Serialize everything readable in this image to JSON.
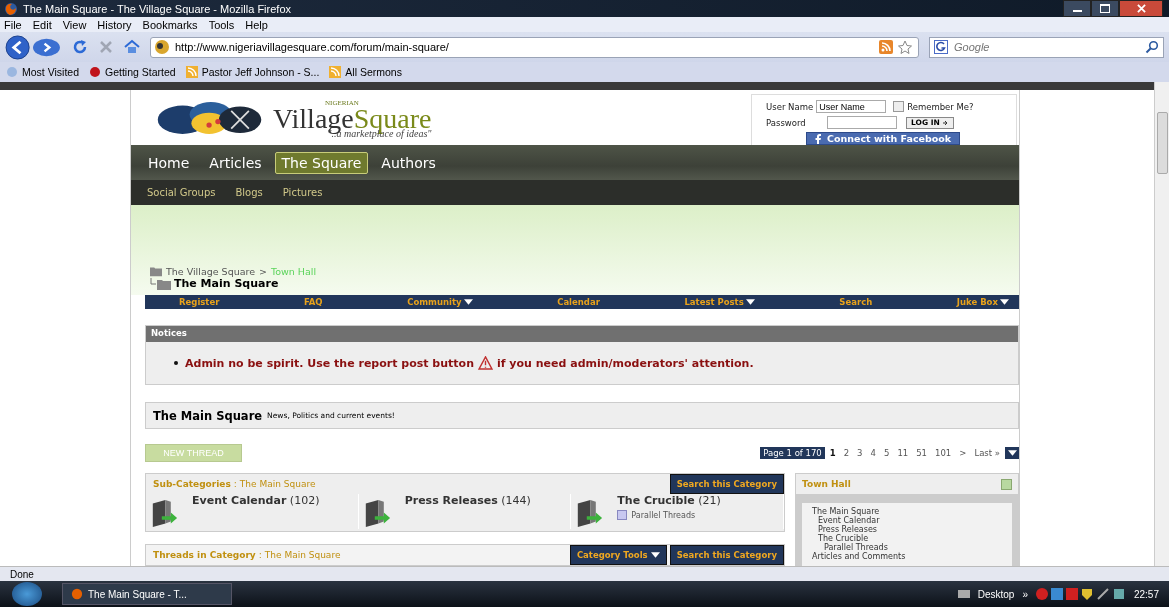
{
  "window": {
    "title": "The Main Square - The Village Square - Mozilla Firefox"
  },
  "menu": [
    "File",
    "Edit",
    "View",
    "History",
    "Bookmarks",
    "Tools",
    "Help"
  ],
  "toolbar": {
    "url": "http://www.nigeriavillagesquare.com/forum/main-square/",
    "search_placeholder": "Google"
  },
  "bookmarks": [
    "Most Visited",
    "Getting Started",
    "Pastor Jeff Johnson - S...",
    "All Sermons"
  ],
  "logo": {
    "small": "NIGERIAN",
    "word1": "Village",
    "word2": "Square",
    "tagline": "\"..a marketplace of ideas\""
  },
  "login": {
    "username_label": "User Name",
    "username_value": "User Name",
    "remember_label": "Remember Me?",
    "remember": false,
    "password_label": "Password",
    "login_button": "LOG IN",
    "facebook_button": "Connect with Facebook"
  },
  "main_nav": [
    {
      "label": "Home",
      "selected": false
    },
    {
      "label": "Articles",
      "selected": false
    },
    {
      "label": "The Square",
      "selected": true
    },
    {
      "label": "Authors",
      "selected": false
    }
  ],
  "sub_nav": [
    "Social Groups",
    "Blogs",
    "Pictures"
  ],
  "breadcrumb": {
    "root": "The Village Square",
    "separator": ">",
    "parent": "Town Hall",
    "current": "The Main Square"
  },
  "forum_nav": [
    {
      "label": "Register",
      "dropdown": false
    },
    {
      "label": "FAQ",
      "dropdown": false
    },
    {
      "label": "Community",
      "dropdown": true
    },
    {
      "label": "Calendar",
      "dropdown": false
    },
    {
      "label": "Latest Posts",
      "dropdown": true
    },
    {
      "label": "Search",
      "dropdown": false
    },
    {
      "label": "Juke Box",
      "dropdown": true
    }
  ],
  "notices": {
    "title": "Notices",
    "text_before": "Admin no be spirit. Use the report post button",
    "text_after": "if you need admin/moderators' attention."
  },
  "forum_header": {
    "title": "The Main Square",
    "description": "News, Politics and current events!"
  },
  "new_thread": "NEW THREAD",
  "pagination": {
    "summary": "Page 1 of 170",
    "pages": [
      {
        "label": "1",
        "selected": true
      },
      {
        "label": "2",
        "selected": false
      },
      {
        "label": "3",
        "selected": false
      },
      {
        "label": "4",
        "selected": false
      },
      {
        "label": "5",
        "selected": false
      },
      {
        "label": "11",
        "selected": false
      },
      {
        "label": "51",
        "selected": false
      },
      {
        "label": "101",
        "selected": false
      },
      {
        "label": ">",
        "selected": false
      },
      {
        "label": "Last »",
        "selected": false
      }
    ]
  },
  "subcategories": {
    "title": "Sub-Categories",
    "separator": ":",
    "forum": "The Main Square",
    "search_button": "Search this Category",
    "items": [
      {
        "name": "Event Calendar",
        "count": "(102)"
      },
      {
        "name": "Press Releases",
        "count": "(144)"
      },
      {
        "name": "The Crucible",
        "count": "(21)",
        "children": [
          "Parallel Threads"
        ]
      }
    ]
  },
  "threads": {
    "title": "Threads in Category",
    "separator": ":",
    "forum": "The Main Square",
    "tools_button": "Category Tools",
    "search_button": "Search this Category"
  },
  "sidebar": {
    "title": "Town Hall",
    "tree": [
      {
        "label": "The Main Square",
        "children": [
          {
            "label": "Event Calendar"
          },
          {
            "label": "Press Releases"
          },
          {
            "label": "The Crucible",
            "children": [
              {
                "label": "Parallel Threads"
              }
            ]
          }
        ]
      },
      {
        "label": "Articles and Comments"
      }
    ]
  },
  "status": "Done",
  "taskbar": {
    "task": "The Main Square - T...",
    "desktop": "Desktop",
    "chevron": "»",
    "clock": "22:57"
  }
}
